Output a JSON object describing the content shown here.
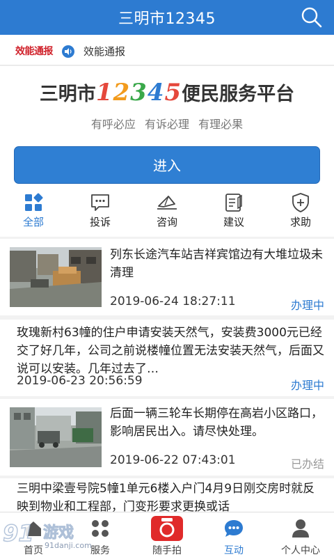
{
  "topbar": {
    "title": "三明市12345",
    "search_icon": "search-icon"
  },
  "notice": {
    "logo_text": "效能通报",
    "label": "效能通报"
  },
  "hero": {
    "brand_prefix": "三明市",
    "brand_number": "12345",
    "brand_suffix": "便民服务平台",
    "slogan": "有呼必应 有诉必理 有理必果",
    "enter_label": "进入"
  },
  "categories": [
    {
      "label": "全部",
      "icon": "grid-icon",
      "active": true
    },
    {
      "label": "投诉",
      "icon": "chat-bubble-icon",
      "active": false
    },
    {
      "label": "咨询",
      "icon": "paper-plane-icon",
      "active": false
    },
    {
      "label": "建议",
      "icon": "clipboard-pen-icon",
      "active": false
    },
    {
      "label": "求助",
      "icon": "shield-plus-icon",
      "active": false
    }
  ],
  "items": [
    {
      "title": "列东长途汽车站吉祥宾馆边有大堆垃圾未清理",
      "time": "2019-06-24 18:27:11",
      "status": "办理中"
    },
    {
      "title": "玫瑰新村63幢的住户申请安装天然气，安装费3000元已经交了好几年，公司之前说楼幢位置无法安装天然气，后面又说可以安装。几年过去了…",
      "time": "2019-06-23 20:56:59",
      "status": "办理中"
    },
    {
      "title": "后面一辆三轮车长期停在高岩小区路口，影响居民出入。请尽快处理。",
      "time": "2019-06-22 07:43:01",
      "status": "已办结"
    },
    {
      "title": "三明中梁壹号院5幢1单元6楼入户门4月9日刚交房时就反映到物业和工程部，门变形要求更换或话",
      "time": "",
      "status": ""
    }
  ],
  "tabs": [
    {
      "label": "首页",
      "icon": "home-icon"
    },
    {
      "label": "服务",
      "icon": "services-grid-icon"
    },
    {
      "label": "随手拍",
      "icon": "camera-icon"
    },
    {
      "label": "互动",
      "icon": "chat-icon"
    },
    {
      "label": "个人中心",
      "icon": "person-icon"
    }
  ],
  "watermark": {
    "logo": "91",
    "name": "游戏",
    "url": "91danji.com"
  },
  "colors": {
    "primary": "#2d7bd1",
    "camera_red": "#e02a2a",
    "done_gray": "#999999"
  }
}
